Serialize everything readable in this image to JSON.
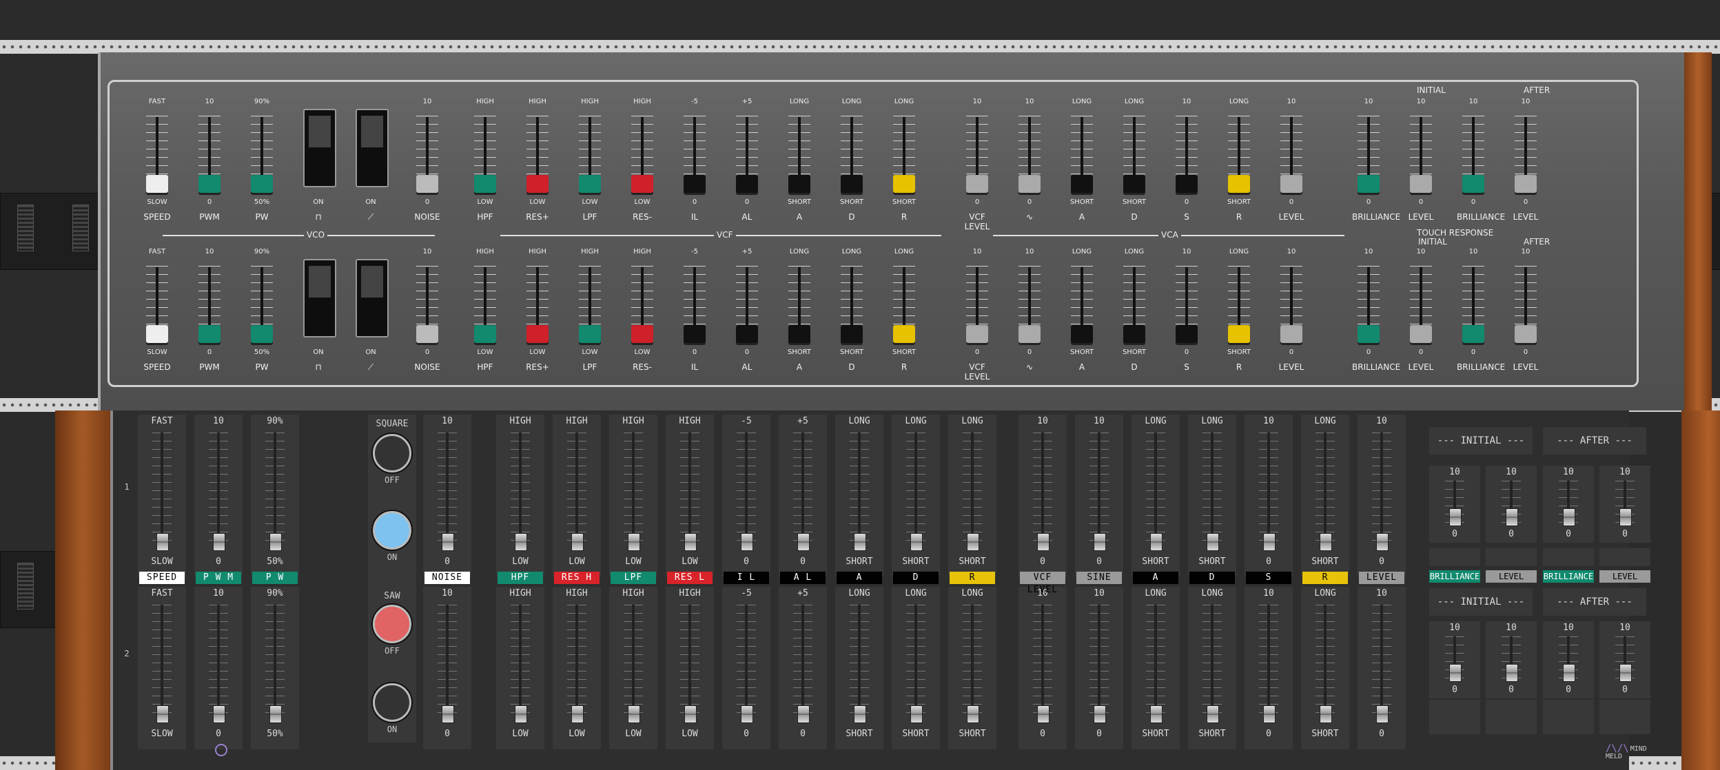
{
  "photo": {
    "sections": {
      "vco": "VCO",
      "vcf": "VCF",
      "vca": "VCA",
      "initial": "INITIAL",
      "after": "AFTER",
      "touch": "TOUCH RESPONSE"
    },
    "row1": [
      {
        "top": "FAST",
        "bot": "SLOW",
        "name": "SPEED",
        "color": "#eeeeee"
      },
      {
        "top": "10",
        "bot": "0",
        "name": "PWM",
        "color": "#118a6e"
      },
      {
        "top": "90%",
        "bot": "50%",
        "name": "PW",
        "color": "#118a6e"
      },
      {
        "switch": true,
        "bot": "ON",
        "name": "⊓"
      },
      {
        "switch": true,
        "bot": "ON",
        "name": "⟋"
      },
      {
        "top": "10",
        "bot": "0",
        "name": "NOISE",
        "color": "#bbbbbb"
      },
      {
        "top": "HIGH",
        "bot": "LOW",
        "name": "HPF",
        "color": "#118a6e"
      },
      {
        "top": "HIGH",
        "bot": "LOW",
        "name": "RES+",
        "color": "#d0202a"
      },
      {
        "top": "HIGH",
        "bot": "LOW",
        "name": "LPF",
        "color": "#118a6e"
      },
      {
        "top": "HIGH",
        "bot": "LOW",
        "name": "RES-",
        "color": "#d0202a"
      },
      {
        "top": "-5",
        "bot": "0",
        "name": "IL",
        "color": "#111111"
      },
      {
        "top": "+5",
        "bot": "0",
        "name": "AL",
        "color": "#111111"
      },
      {
        "top": "LONG",
        "bot": "SHORT",
        "name": "A",
        "color": "#111111"
      },
      {
        "top": "LONG",
        "bot": "SHORT",
        "name": "D",
        "color": "#111111"
      },
      {
        "top": "LONG",
        "bot": "SHORT",
        "name": "R",
        "color": "#e6c200"
      },
      {
        "top": "10",
        "bot": "0",
        "name": "VCF LEVEL",
        "color": "#aaaaaa"
      },
      {
        "top": "10",
        "bot": "0",
        "name": "∿",
        "color": "#aaaaaa"
      },
      {
        "top": "LONG",
        "bot": "SHORT",
        "name": "A",
        "color": "#111111"
      },
      {
        "top": "LONG",
        "bot": "SHORT",
        "name": "D",
        "color": "#111111"
      },
      {
        "top": "10",
        "bot": "0",
        "name": "S",
        "color": "#111111"
      },
      {
        "top": "LONG",
        "bot": "SHORT",
        "name": "R",
        "color": "#e6c200"
      },
      {
        "top": "10",
        "bot": "0",
        "name": "LEVEL",
        "color": "#aaaaaa"
      },
      {
        "top": "10",
        "bot": "0",
        "name": "BRILLIANCE",
        "color": "#118a6e"
      },
      {
        "top": "10",
        "bot": "0",
        "name": "LEVEL",
        "color": "#aaaaaa"
      },
      {
        "top": "10",
        "bot": "0",
        "name": "BRILLIANCE",
        "color": "#118a6e"
      },
      {
        "top": "10",
        "bot": "0",
        "name": "LEVEL",
        "color": "#aaaaaa"
      }
    ]
  },
  "lower": {
    "row_numbers": [
      "1",
      "2"
    ],
    "buttons": {
      "square": "SQUARE",
      "off1": "OFF",
      "on1": "ON",
      "saw": "SAW",
      "off2": "OFF",
      "on2": "ON"
    },
    "colors": {
      "teal": "#118a6e",
      "red": "#d8232a",
      "yellow": "#e8c30a",
      "gray": "#9a9a9a",
      "white": "#ffffff",
      "black": "#000000",
      "btn_blue": "#7ec3f0",
      "btn_red": "#e06464",
      "btn_dark": "#333333"
    },
    "labels": [
      {
        "t": "SPEED",
        "bg": "#ffffff",
        "fg": "#000"
      },
      {
        "t": "P W M",
        "bg": "#118a6e",
        "fg": "#fff"
      },
      {
        "t": "P W",
        "bg": "#118a6e",
        "fg": "#fff"
      },
      {
        "t": "NOISE",
        "bg": "#ffffff",
        "fg": "#000"
      },
      {
        "t": "HPF",
        "bg": "#118a6e",
        "fg": "#fff"
      },
      {
        "t": "RES H",
        "bg": "#d8232a",
        "fg": "#fff"
      },
      {
        "t": "LPF",
        "bg": "#118a6e",
        "fg": "#fff"
      },
      {
        "t": "RES L",
        "bg": "#d8232a",
        "fg": "#fff"
      },
      {
        "t": "I L",
        "bg": "#000000",
        "fg": "#fff"
      },
      {
        "t": "A L",
        "bg": "#000000",
        "fg": "#fff"
      },
      {
        "t": "A",
        "bg": "#000000",
        "fg": "#fff"
      },
      {
        "t": "D",
        "bg": "#000000",
        "fg": "#fff"
      },
      {
        "t": "R",
        "bg": "#e8c30a",
        "fg": "#000"
      },
      {
        "t": "VCF LEVEL",
        "bg": "#9a9a9a",
        "fg": "#000"
      },
      {
        "t": "SINE",
        "bg": "#9a9a9a",
        "fg": "#000"
      },
      {
        "t": "A",
        "bg": "#000000",
        "fg": "#fff"
      },
      {
        "t": "D",
        "bg": "#000000",
        "fg": "#fff"
      },
      {
        "t": "S",
        "bg": "#000000",
        "fg": "#fff"
      },
      {
        "t": "R",
        "bg": "#e8c30a",
        "fg": "#000"
      },
      {
        "t": "LEVEL",
        "bg": "#9a9a9a",
        "fg": "#000"
      },
      {
        "t": "BRILLIANCE",
        "bg": "#118a6e",
        "fg": "#fff"
      },
      {
        "t": "LEVEL",
        "bg": "#9a9a9a",
        "fg": "#000"
      },
      {
        "t": "BRILLIANCE",
        "bg": "#118a6e",
        "fg": "#fff"
      },
      {
        "t": "LEVEL",
        "bg": "#9a9a9a",
        "fg": "#000"
      }
    ],
    "row1": [
      {
        "top": "FAST",
        "bot": "SLOW"
      },
      {
        "top": "10",
        "bot": "0"
      },
      {
        "top": "90%",
        "bot": "50%"
      },
      {
        "top": "10",
        "bot": "0"
      },
      {
        "top": "HIGH",
        "bot": "LOW"
      },
      {
        "top": "HIGH",
        "bot": "LOW"
      },
      {
        "top": "HIGH",
        "bot": "LOW"
      },
      {
        "top": "HIGH",
        "bot": "LOW"
      },
      {
        "top": "-5",
        "bot": "0"
      },
      {
        "top": "+5",
        "bot": "0"
      },
      {
        "top": "LONG",
        "bot": "SHORT"
      },
      {
        "top": "LONG",
        "bot": "SHORT"
      },
      {
        "top": "LONG",
        "bot": "SHORT"
      },
      {
        "top": "10",
        "bot": "0"
      },
      {
        "top": "10",
        "bot": "0"
      },
      {
        "top": "LONG",
        "bot": "SHORT"
      },
      {
        "top": "LONG",
        "bot": "SHORT"
      },
      {
        "top": "10",
        "bot": "0"
      },
      {
        "top": "LONG",
        "bot": "SHORT"
      },
      {
        "top": "10",
        "bot": "0"
      }
    ],
    "row2": [
      {
        "top": "FAST",
        "bot": "SLOW"
      },
      {
        "top": "10",
        "bot": "0"
      },
      {
        "top": "90%",
        "bot": "50%"
      },
      {
        "top": "10",
        "bot": "0"
      },
      {
        "top": "HIGH",
        "bot": "LOW"
      },
      {
        "top": "HIGH",
        "bot": "LOW"
      },
      {
        "top": "HIGH",
        "bot": "LOW"
      },
      {
        "top": "HIGH",
        "bot": "LOW"
      },
      {
        "top": "-5",
        "bot": "0"
      },
      {
        "top": "+5",
        "bot": "0"
      },
      {
        "top": "LONG",
        "bot": "SHORT"
      },
      {
        "top": "LONG",
        "bot": "SHORT"
      },
      {
        "top": "LONG",
        "bot": "SHORT"
      },
      {
        "top": "10",
        "bot": "0"
      },
      {
        "top": "10",
        "bot": "0"
      },
      {
        "top": "LONG",
        "bot": "SHORT"
      },
      {
        "top": "LONG",
        "bot": "SHORT"
      },
      {
        "top": "10",
        "bot": "0"
      },
      {
        "top": "LONG",
        "bot": "SHORT"
      },
      {
        "top": "10",
        "bot": "0"
      }
    ],
    "touch": {
      "initial": "--- INITIAL ---",
      "after": "--- AFTER ---",
      "top": "10",
      "bot": "0"
    },
    "logo": {
      "mark": "/\\/\\",
      "line1": "MIND",
      "line2": "MELD"
    }
  }
}
